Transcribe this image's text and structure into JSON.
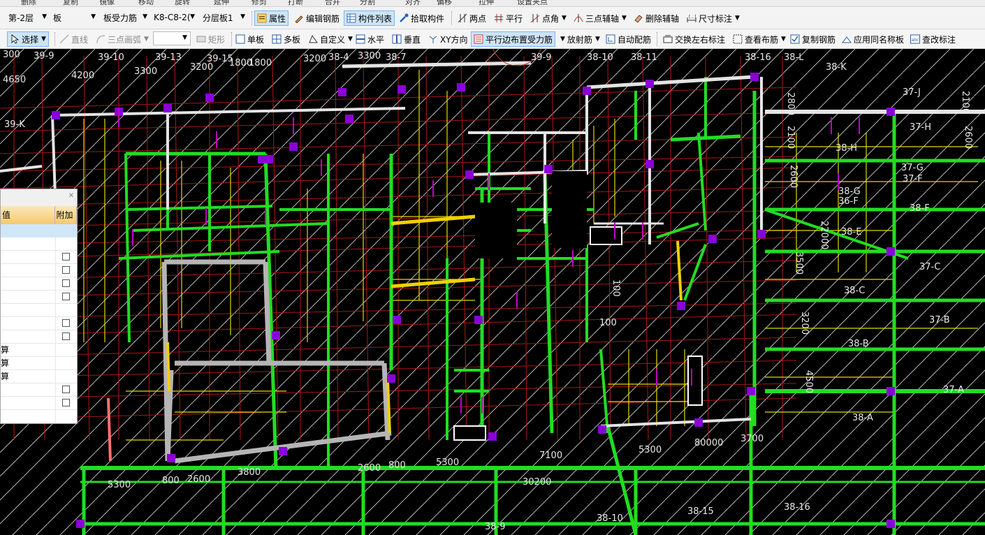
{
  "toolbar_top": {
    "fragments": [
      "删除",
      "复制",
      "镜像",
      "移动",
      "旋转",
      "延伸",
      "修剪",
      "打断",
      "合并",
      "分割",
      "对齐",
      "偏移",
      "拉伸",
      "设置夹点"
    ]
  },
  "toolbar_main": {
    "floor": "第-2层",
    "type": "板",
    "subtype": "板受力筋",
    "rebar": "K8-C8-2(",
    "layer": "分层板1",
    "props_btn": "属性",
    "edit_rebar_btn": "编辑钢筋",
    "component_list_btn": "构件列表",
    "pick_btn": "拾取构件",
    "two_point_btn": "两点",
    "parallel_btn": "平行",
    "point_angle_btn": "点角",
    "three_point_axis_btn": "三点辅轴",
    "delete_axis_btn": "删除辅轴",
    "dimension_btn": "尺寸标注"
  },
  "toolbar_draw": {
    "select_btn": "选择",
    "line_btn": "直线",
    "arc_btn": "三点画弧",
    "combo_value": "",
    "rect_btn": "矩形",
    "single_board_btn": "单板",
    "multi_board_btn": "多板",
    "custom_btn": "自定义",
    "horizontal_btn": "水平",
    "vertical_btn": "垂直",
    "xy_btn": "XY方向",
    "parallel_edge_btn": "平行边布置受力筋",
    "radial_btn": "放射筋",
    "auto_btn": "自动配筋",
    "swap_btn": "交换左右标注",
    "view_btn": "查看布筋",
    "copy_btn": "复制钢筋",
    "apply_btn": "应用同名称板",
    "change_btn": "查改标注"
  },
  "panel": {
    "col_value": "值",
    "col_extra": "附加",
    "rows": [
      {
        "value": "",
        "check": false
      },
      {
        "value": "",
        "check": true
      },
      {
        "value": "",
        "check": true
      },
      {
        "value": "",
        "check": true
      },
      {
        "value": "",
        "check": true
      },
      {
        "value": "",
        "check": false
      },
      {
        "value": "",
        "check": true
      },
      {
        "value": "",
        "check": true
      },
      {
        "value": "算",
        "check": false
      },
      {
        "value": "算",
        "check": false
      },
      {
        "value": "算",
        "check": false
      },
      {
        "value": "",
        "check": true
      },
      {
        "value": "",
        "check": true
      },
      {
        "value": "",
        "check": false
      }
    ]
  },
  "drawing": {
    "labels": [
      {
        "text": "300"
      },
      {
        "text": "39-9"
      },
      {
        "text": "39-10"
      },
      {
        "text": "39-13"
      },
      {
        "text": "39-15"
      },
      {
        "text": "1800"
      },
      {
        "text": "3200"
      },
      {
        "text": "38-4"
      },
      {
        "text": "3300"
      },
      {
        "text": "38-7"
      },
      {
        "text": "39-9"
      },
      {
        "text": "38-10"
      },
      {
        "text": "38-11"
      },
      {
        "text": "38-16"
      },
      {
        "text": "38-L"
      },
      {
        "text": "38-K"
      },
      {
        "text": "4200"
      },
      {
        "text": "3300"
      },
      {
        "text": "3200"
      },
      {
        "text": "1800"
      },
      {
        "text": "4650"
      },
      {
        "text": "39-K"
      },
      {
        "text": "37-J"
      },
      {
        "text": "2800"
      },
      {
        "text": "2100"
      },
      {
        "text": "37-H"
      },
      {
        "text": "38-H"
      },
      {
        "text": "2100"
      },
      {
        "text": "2600"
      },
      {
        "text": "37-G"
      },
      {
        "text": "37-F"
      },
      {
        "text": "38-G"
      },
      {
        "text": "36-F"
      },
      {
        "text": "2600"
      },
      {
        "text": "38-F"
      },
      {
        "text": "22000"
      },
      {
        "text": "38-E"
      },
      {
        "text": "37-C"
      },
      {
        "text": "3500"
      },
      {
        "text": "38-C"
      },
      {
        "text": "100"
      },
      {
        "text": "3200"
      },
      {
        "text": "37-B"
      },
      {
        "text": "100"
      },
      {
        "text": "38-B"
      },
      {
        "text": "4500"
      },
      {
        "text": "38-A"
      },
      {
        "text": "5300"
      },
      {
        "text": "80000"
      },
      {
        "text": "3700"
      },
      {
        "text": "7100"
      },
      {
        "text": "5300"
      },
      {
        "text": "2600"
      },
      {
        "text": "800"
      },
      {
        "text": "3800"
      },
      {
        "text": "5300"
      },
      {
        "text": "800"
      },
      {
        "text": "2600"
      },
      {
        "text": "30200"
      },
      {
        "text": "38-10"
      },
      {
        "text": "38-16"
      },
      {
        "text": "38-15"
      },
      {
        "text": "38-9"
      },
      {
        "text": "37-A"
      }
    ]
  }
}
